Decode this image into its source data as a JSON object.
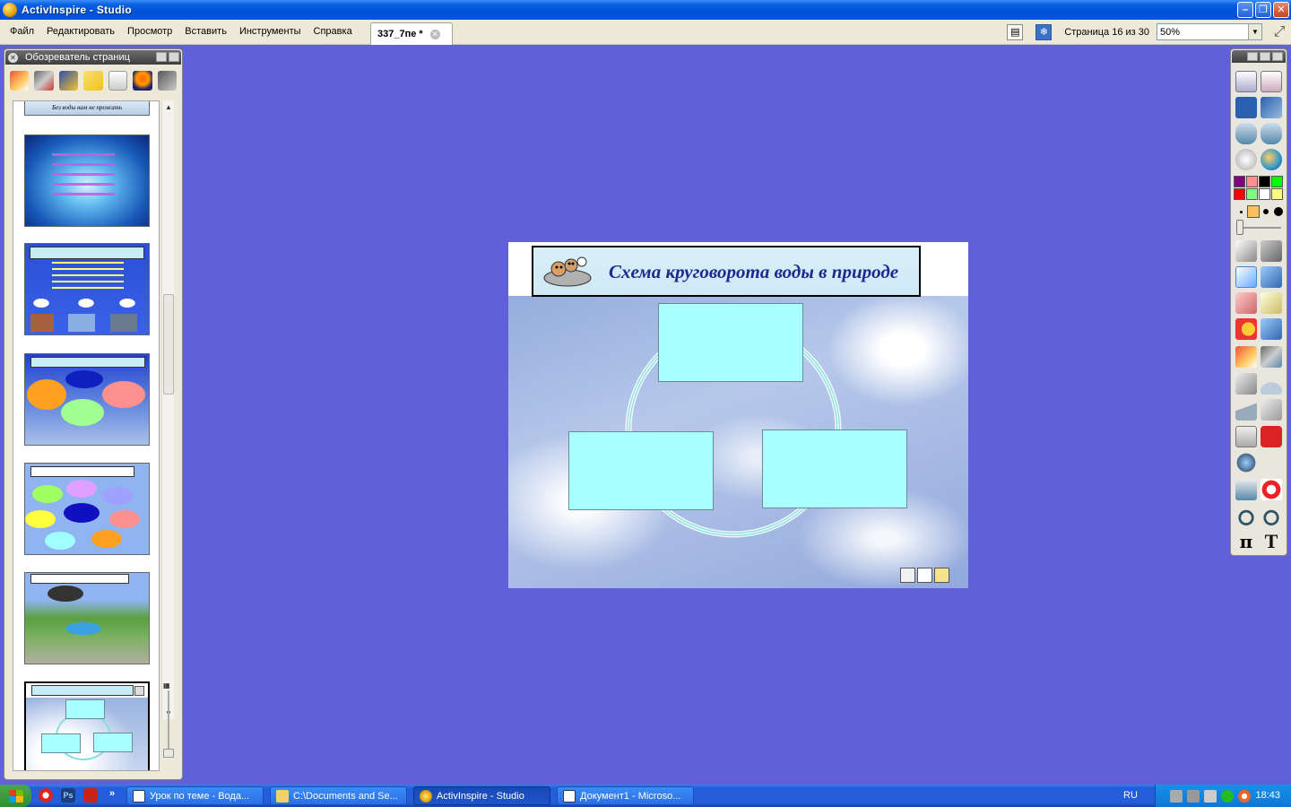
{
  "window": {
    "title": "ActivInspire - Studio"
  },
  "menu": [
    "Файл",
    "Редактировать",
    "Просмотр",
    "Вставить",
    "Инструменты",
    "Справка"
  ],
  "document_tab": {
    "label": "337_7пе *"
  },
  "page_indicator": "Страница 16 из 30",
  "zoom": {
    "value": "50%"
  },
  "browser": {
    "title": "Обозреватель страниц",
    "thumbnails": [
      {
        "caption": "Без воды нам не прожить",
        "selected": false
      },
      {
        "caption": "",
        "selected": false
      },
      {
        "caption": "",
        "selected": false
      },
      {
        "caption": "",
        "selected": false
      },
      {
        "caption": "",
        "selected": false
      },
      {
        "caption": "",
        "selected": false
      },
      {
        "caption": "",
        "selected": true
      }
    ]
  },
  "slide": {
    "title": "Схема круговорота воды в природе"
  },
  "colors": {
    "desktop": "#6060d8",
    "box_fill": "#aaffff",
    "title_text": "#1c2a8e",
    "taskbar": "#245edb"
  },
  "toolbox": {
    "tools": [
      "page-browser-icon",
      "note-icon",
      "annotate-icon",
      "desktop-tools-icon",
      "prev-page-icon",
      "next-page-icon",
      "play-icon",
      "web-icon",
      "select-icon",
      "magic-tools-icon",
      "pen-icon",
      "highlighter-icon",
      "eraser-icon",
      "fill-icon",
      "shape-icon",
      "connector-icon",
      "resource-icon",
      "flipchart-icon",
      "ruler-icon",
      "protractor-icon",
      "triangle-icon",
      "compass-icon",
      "calculator-icon",
      "dice-icon",
      "spotlight-icon",
      "reset-icon",
      "undo-icon",
      "redo-icon",
      "pi-icon",
      "text-icon"
    ],
    "palette": [
      "#800080",
      "#ff9090",
      "#000000",
      "#00ff00",
      "#ff0000",
      "#80ff80",
      "#ffffff",
      "#ffff80"
    ]
  },
  "taskbar": {
    "tasks": [
      {
        "label": "Урок по теме - Вода...",
        "active": false
      },
      {
        "label": "C:\\Documents and Se...",
        "active": false
      },
      {
        "label": "ActivInspire - Studio",
        "active": true
      },
      {
        "label": "Документ1 - Microso...",
        "active": false
      }
    ],
    "quicklaunch_more": "»",
    "lang": "RU",
    "clock": "18:43"
  }
}
